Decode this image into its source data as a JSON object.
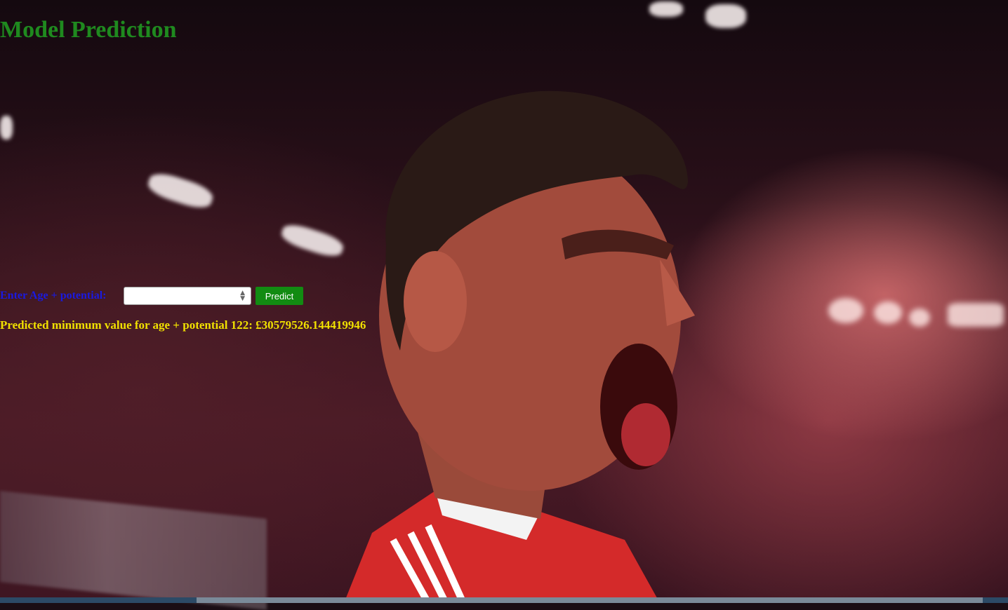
{
  "page": {
    "title": "Model Prediction"
  },
  "form": {
    "label": "Enter Age + potential:",
    "input_value": "",
    "button_label": "Predict"
  },
  "result": {
    "text": "Predicted minimum value for age + potential 122: £30579526.144419946"
  },
  "colors": {
    "title": "#1f8a1f",
    "label": "#1a1adf",
    "button": "#128b12",
    "result": "#f0e000"
  },
  "icons": {
    "spinner": "number-spinner-icon"
  }
}
